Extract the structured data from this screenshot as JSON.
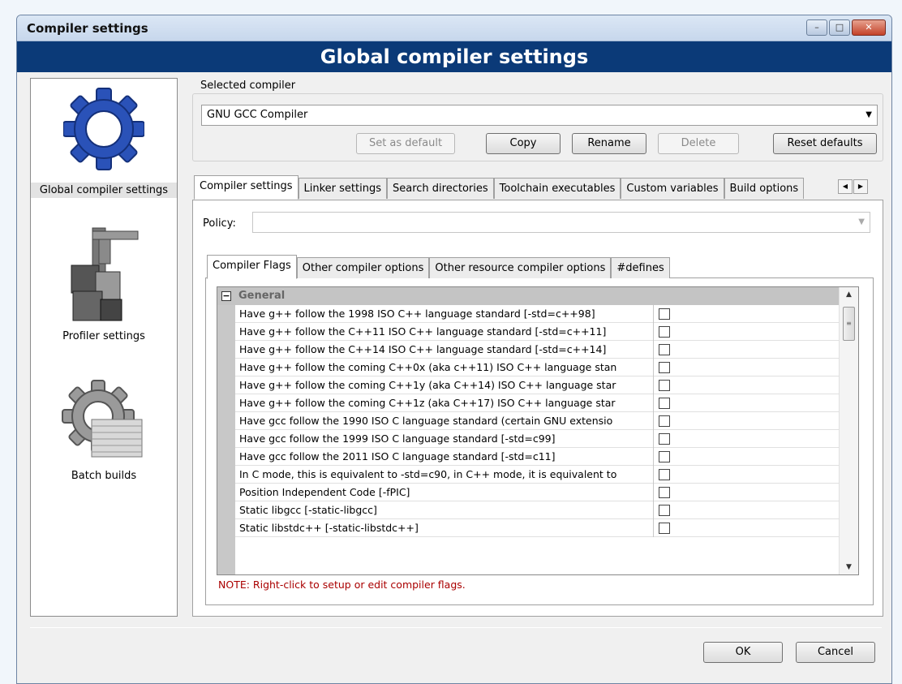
{
  "window": {
    "title": "Compiler settings",
    "banner": "Global compiler settings",
    "minimize_icon": "minimize-icon",
    "maximize_icon": "maximize-icon",
    "close_icon": "close-icon"
  },
  "sidebar": {
    "items": [
      {
        "label": "Global compiler settings",
        "icon": "gear-icon"
      },
      {
        "label": "Profiler settings",
        "icon": "caliper-icon"
      },
      {
        "label": "Batch builds",
        "icon": "gear-stack-icon"
      }
    ]
  },
  "compiler": {
    "group_label": "Selected compiler",
    "selected": "GNU GCC Compiler",
    "buttons": {
      "set_default": "Set as default",
      "copy": "Copy",
      "rename": "Rename",
      "delete": "Delete",
      "reset": "Reset defaults"
    }
  },
  "tabs": [
    "Compiler settings",
    "Linker settings",
    "Search directories",
    "Toolchain executables",
    "Custom variables",
    "Build options"
  ],
  "policy": {
    "label": "Policy:",
    "value": ""
  },
  "subtabs": [
    "Compiler Flags",
    "Other compiler options",
    "Other resource compiler options",
    "#defines"
  ],
  "flags": {
    "group": "General",
    "rows": [
      "Have g++ follow the 1998 ISO C++ language standard  [-std=c++98]",
      "Have g++ follow the C++11 ISO C++ language standard  [-std=c++11]",
      "Have g++ follow the C++14 ISO C++ language standard  [-std=c++14]",
      "Have g++ follow the coming C++0x (aka c++11) ISO C++ language stan",
      "Have g++ follow the coming C++1y (aka C++14) ISO C++ language star",
      "Have g++ follow the coming C++1z (aka C++17) ISO C++ language star",
      "Have gcc follow the 1990 ISO C language standard  (certain GNU extensio",
      "Have gcc follow the 1999 ISO C language standard  [-std=c99]",
      "Have gcc follow the 2011 ISO C language standard  [-std=c11]",
      "In C mode, this is equivalent to -std=c90, in C++ mode, it is equivalent to",
      "Position Independent Code  [-fPIC]",
      "Static libgcc  [-static-libgcc]",
      "Static libstdc++  [-static-libstdc++]"
    ],
    "checked": [
      false,
      false,
      false,
      false,
      false,
      false,
      false,
      false,
      false,
      false,
      false,
      false,
      false
    ]
  },
  "note": "NOTE: Right-click to setup or edit compiler flags.",
  "footer": {
    "ok": "OK",
    "cancel": "Cancel"
  }
}
